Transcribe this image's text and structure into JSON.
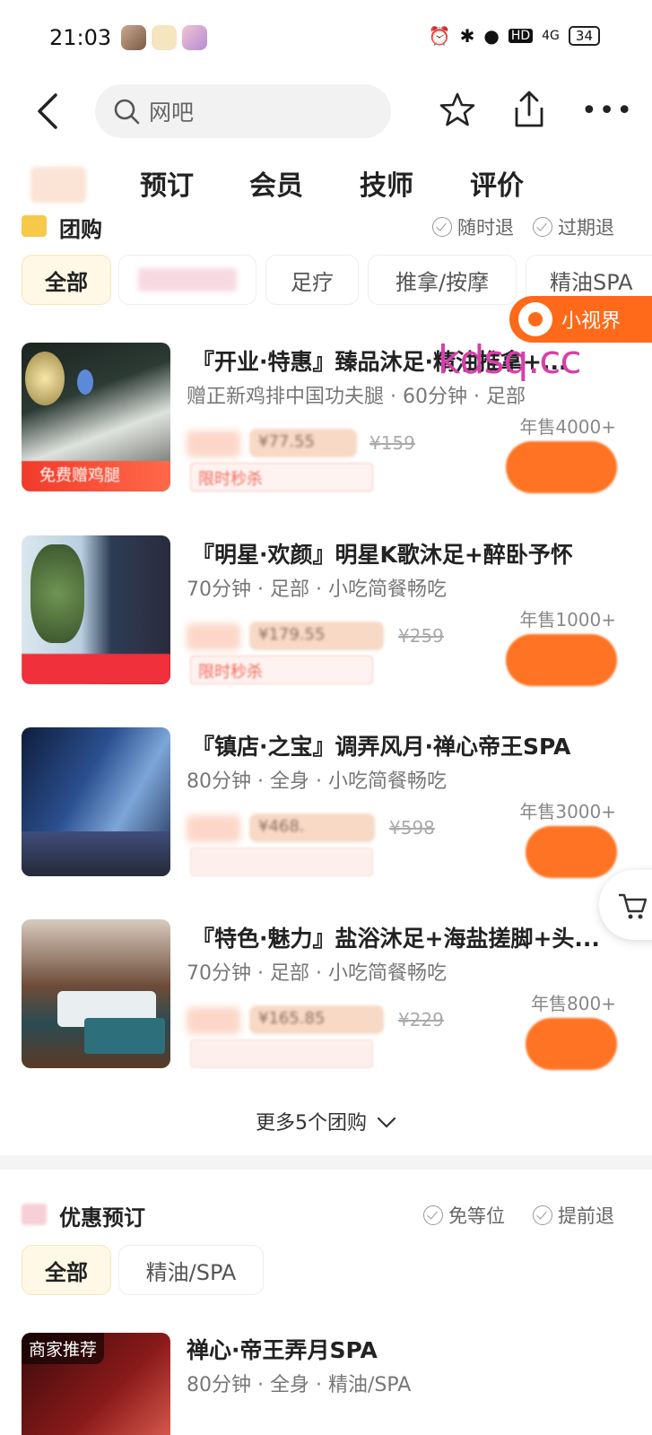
{
  "status_bar": {
    "time": "21:03",
    "battery": "34",
    "network": "4G",
    "hd": "HD"
  },
  "nav": {
    "search_placeholder": "网吧"
  },
  "tabs": [
    "预订",
    "会员",
    "技师",
    "评价"
  ],
  "group_buy": {
    "title": "团购",
    "guarantees": [
      "随时退",
      "过期退"
    ],
    "filters": [
      "全部",
      "足疗",
      "推拿/按摩",
      "精油SPA"
    ],
    "mini_view_label": "小视界",
    "watermark": "kdsq.cc",
    "deals": [
      {
        "title": "『开业·特惠』臻品沐足·精油推拿+...",
        "subtitle": "赠正新鸡排中国功夫腿 · 60分钟 · 足部",
        "sales": "年售4000+",
        "price_hint": "¥77.55",
        "original_price": "¥159",
        "limit_label": "限时秒杀",
        "image_tag": "免费赠鸡腿"
      },
      {
        "title": "『明星·欢颜』明星K歌沐足+醉卧予怀",
        "subtitle": "70分钟 · 足部 · 小吃简餐畅吃",
        "sales": "年售1000+",
        "price_hint": "¥179.55",
        "original_price": "¥259",
        "limit_label": "限时秒杀",
        "image_tag": ""
      },
      {
        "title": "『镇店·之宝』调弄风月·禅心帝王SPA",
        "subtitle": "80分钟 · 全身 · 小吃简餐畅吃",
        "sales": "年售3000+",
        "price_hint": "¥468.",
        "original_price": "¥598",
        "limit_label": "",
        "image_tag": ""
      },
      {
        "title": "『特色·魅力』盐浴沐足+海盐搓脚+头...",
        "subtitle": "70分钟 · 足部 · 小吃简餐畅吃",
        "sales": "年售800+",
        "price_hint": "¥165.85",
        "original_price": "¥229",
        "limit_label": "",
        "image_tag": ""
      }
    ],
    "more_link": "更多5个团购"
  },
  "booking": {
    "title": "优惠预订",
    "guarantees": [
      "免等位",
      "提前退"
    ],
    "filters": [
      "全部",
      "精油/SPA"
    ],
    "item": {
      "badge": "商家推荐",
      "title": "禅心·帝王弄月SPA",
      "subtitle": "80分钟 · 全身 · 精油/SPA"
    }
  },
  "colors": {
    "accent": "#ff7424",
    "badge_orange": "#ff6a1a",
    "watermark": "#d83fa9"
  }
}
